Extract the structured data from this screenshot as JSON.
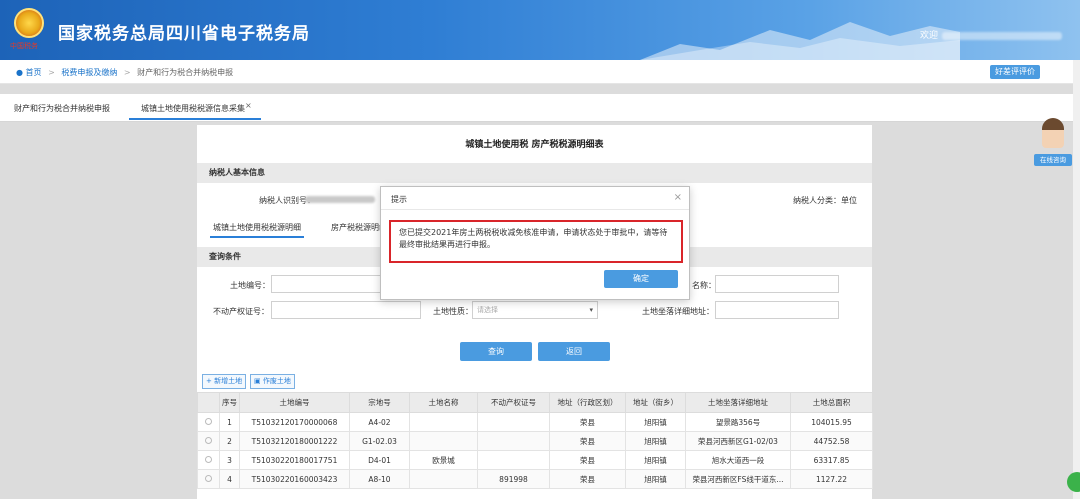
{
  "header": {
    "site_title": "国家税务总局四川省电子税务局",
    "emblem_caption": "中国税务",
    "welcome": "欢迎"
  },
  "breadcrumb": {
    "items": [
      "首页",
      "税费申报及缴纳",
      "财产和行为税合并纳税申报"
    ]
  },
  "review_button": "好差评评价",
  "tabs": [
    {
      "label": "财产和行为税合并纳税申报",
      "active": false
    },
    {
      "label": "城镇土地使用税税源信息采集",
      "active": true,
      "closable": true
    }
  ],
  "panel": {
    "title": "城镇土地使用税 房产税税源明细表",
    "taxpayer_section": "纳税人基本信息",
    "taxpayer_id_label": "纳税人识别号：",
    "taxpayer_type_label": "纳税人分类：单位",
    "subtabs": [
      "城镇土地使用税税源明细",
      "房产税税源明细"
    ],
    "query_section": "查询条件",
    "fields": {
      "land_no_label": "土地编号：",
      "land_name_label": "名称：",
      "cert_label": "不动产权证号：",
      "land_nature_label": "土地性质：",
      "land_nature_placeholder": "请选择",
      "address_label": "土地坐落详细地址："
    },
    "query_button": "查询",
    "back_button": "返回",
    "add_land_button": "+ 新增土地",
    "void_land_button": "作废土地"
  },
  "table": {
    "headers": [
      "",
      "序号",
      "土地编号",
      "宗地号",
      "土地名称",
      "不动产权证号",
      "地址（行政区划）",
      "地址（街乡）",
      "土地坐落详细地址",
      "土地总面积"
    ],
    "rows": [
      [
        "1",
        "T51032120170000068",
        "A4-02",
        "",
        "",
        "荣县",
        "旭阳镇",
        "望景路356号",
        "104015.95"
      ],
      [
        "2",
        "T51032120180001222",
        "G1-02.03",
        "",
        "",
        "荣县",
        "旭阳镇",
        "荣县河西新区G1-02/03",
        "44752.58"
      ],
      [
        "3",
        "T51030220180017751",
        "D4-01",
        "欧景城",
        "",
        "荣县",
        "旭阳镇",
        "旭水大道西一段",
        "63317.85"
      ],
      [
        "4",
        "T51030220160003423",
        "A8-10",
        "",
        "891998",
        "荣县",
        "旭阳镇",
        "荣县河西新区FS线干道东...",
        "1127.22"
      ]
    ]
  },
  "help_widget": "在线咨询",
  "modal": {
    "title": "提示",
    "close": "×",
    "message": "您已提交2021年房土两税税收减免核准申请，申请状态处于审批中，请等待最终审批结果再进行申报。",
    "ok_button": "确定"
  }
}
